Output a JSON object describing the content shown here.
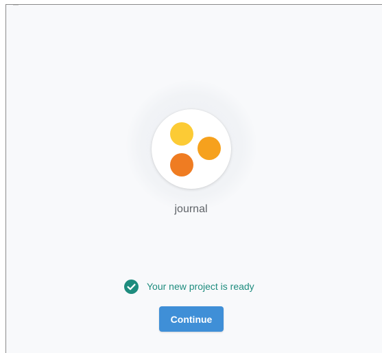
{
  "project": {
    "name": "journal",
    "logo_dots": [
      {
        "name": "yellow-dot",
        "color": "#fccb35"
      },
      {
        "name": "amber-dot",
        "color": "#f6a11d"
      },
      {
        "name": "orange-dot",
        "color": "#ef7c22"
      }
    ]
  },
  "status": {
    "icon": "check-circle-icon",
    "text": "Your new project is ready",
    "color": "#1e8c7e"
  },
  "actions": {
    "continue_label": "Continue",
    "continue_color": "#3f8fd7"
  }
}
